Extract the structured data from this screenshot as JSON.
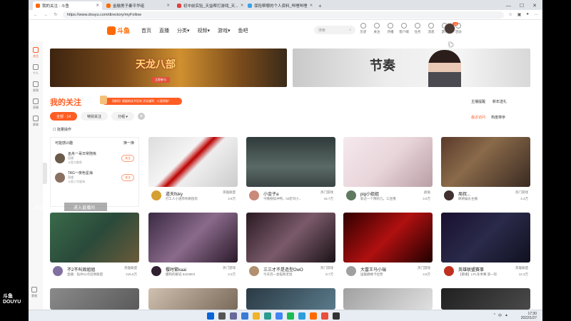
{
  "browser": {
    "tabs": [
      {
        "label": "我的关注 - 斗鱼",
        "active": true
      },
      {
        "label": "金融男子秦平华组",
        "active": false
      },
      {
        "label": "初中前实验_天益帮打游戏_天...",
        "active": false
      },
      {
        "label": "保险帮哪的个人资料_哔哩哔哩",
        "active": false
      }
    ],
    "tab_close": "✕",
    "new_tab": "+",
    "url": "https://www.douyu.com/directory/myFollow",
    "back_glyph": "←",
    "forward_glyph": "→",
    "reload_glyph": "↻",
    "window_controls": [
      "—",
      "☐",
      "✕"
    ]
  },
  "site_header": {
    "logo_text": "斗鱼",
    "nav": [
      "首页",
      "直播",
      "分类▾",
      "视频▾",
      "游戏▾",
      "鱼吧"
    ],
    "search_placeholder": "搜索",
    "header_icons": [
      "历史",
      "关注",
      "开播",
      "客户端",
      "任务",
      "消息",
      "游戏",
      "活动"
    ],
    "avatar_badge": "14"
  },
  "sidebar": {
    "items": [
      {
        "label": "关注",
        "active": true
      },
      {
        "label": "个人",
        "active": false
      },
      {
        "label": "视频",
        "active": false
      },
      {
        "label": "直播",
        "active": false
      },
      {
        "label": "赛事",
        "active": false
      }
    ],
    "bottom_item": "客服"
  },
  "banners": [
    {
      "title": "天龙八部",
      "button": "立即参与"
    },
    {
      "title": "节奏"
    }
  ],
  "follow": {
    "title": "我的关注",
    "promo": "【福利】超级粉丝节狂欢 活动福利 · 火速领取！",
    "top_links": [
      "主播提醒",
      "新年送礼"
    ],
    "filters": [
      "全部 · 14",
      "特别关注",
      "分组 ▾"
    ],
    "add": "+",
    "sort_links": [
      "最近访问",
      "热度排序"
    ],
    "batch_op": "批量操作"
  },
  "recommend": {
    "title": "可能感兴趣",
    "refresh": "换一换",
    "items": [
      {
        "name": "巫舟一哥日常陪练",
        "sub1": "直播",
        "sub2": "斗鱼大鲸鱼",
        "button": "关注"
      },
      {
        "name": "TAG一夜色星海",
        "sub1": "直播",
        "sub2": "斗鱼二号星海",
        "button": "关注"
      }
    ]
  },
  "danmaku": {
    "left": "欢迎",
    "right": "进入直播间"
  },
  "cards": [
    {
      "name": "道天flsky",
      "title": "打工人小道带你刷陪玩",
      "category": "英雄联盟",
      "hot": "4.5万"
    },
    {
      "name": "小金子a",
      "title": "今晚继续冲鸭，lol老司小...",
      "category": "热门游戏",
      "hot": "44.7万"
    },
    {
      "name": "pig小姐姐",
      "title": "新过一个拜的几，三连哦",
      "category": "颜值",
      "hot": "3.5万"
    },
    {
      "name": "周叔...",
      "title": "麻将娱乐主播",
      "category": "热门游戏",
      "hot": "4.4万"
    },
    {
      "name": "不2不叫周姐姐",
      "title": "直播：钻冲21点召唤联盟",
      "category": "英雄联盟",
      "hot": "216.5万"
    },
    {
      "name": "樱时繁kaai",
      "title": "樱和的解说 6423804",
      "category": "热门游戏",
      "hot": "3.2万"
    },
    {
      "name": "三三才不是造型OwO",
      "title": "今天玩一会猫和老鼠",
      "category": "热门游戏",
      "hot": "8.7万"
    },
    {
      "name": "大富王马小瑞",
      "title": "国服巅峰卡拉赞",
      "category": "热门游戏",
      "hot": "3.5万"
    },
    {
      "name": "英雄联盟赛事",
      "title": "【重播】LPL冬季赛 第一轮",
      "category": "英雄联盟",
      "hot": "12.3万"
    }
  ],
  "taskbar": {
    "tray": [
      "^",
      "中",
      "▲"
    ],
    "time": "17:30",
    "date": "2022/1/27"
  },
  "colors": {
    "accent": "#ff5d23",
    "brand": "#ff6a00"
  }
}
